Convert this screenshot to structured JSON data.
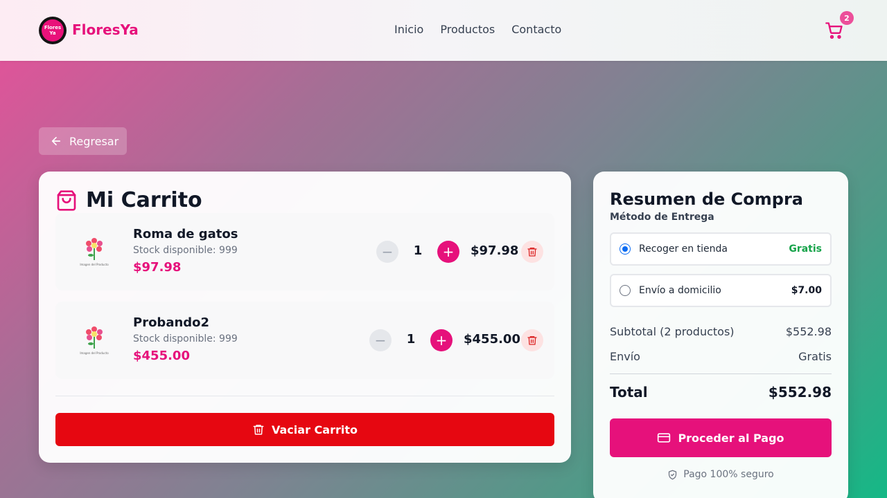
{
  "nav": {
    "brand": "FloresYa",
    "logo_text_line1": "Flores",
    "logo_text_line2": "Ya",
    "links": [
      "Inicio",
      "Productos",
      "Contacto"
    ],
    "cart_count": "2"
  },
  "back_label": "Regresar",
  "cart": {
    "title": "Mi Carrito",
    "image_caption": "Imagen del Producto",
    "items": [
      {
        "name": "Roma de gatos",
        "stock": "Stock disponible: 999",
        "price": "$97.98",
        "qty": "1",
        "total": "$97.98"
      },
      {
        "name": "Probando2",
        "stock": "Stock disponible: 999",
        "price": "$455.00",
        "qty": "1",
        "total": "$455.00"
      }
    ],
    "empty_label": "Vaciar Carrito"
  },
  "summary": {
    "title": "Resumen de Compra",
    "delivery_heading": "Método de Entrega",
    "options": [
      {
        "label": "Recoger en tienda",
        "price": "Gratis",
        "selected": true
      },
      {
        "label": "Envío a domicilio",
        "price": "$7.00",
        "selected": false
      }
    ],
    "subtotal_label": "Subtotal (2 productos)",
    "subtotal_value": "$552.98",
    "shipping_label": "Envío",
    "shipping_value": "Gratis",
    "total_label": "Total",
    "total_value": "$552.98",
    "pay_label": "Proceder al Pago",
    "secure_label": "Pago 100% seguro"
  },
  "colors": {
    "accent": "#e6117b",
    "danger": "#e60711",
    "free_green": "#16a34a",
    "radio_blue": "#0b6bf2"
  }
}
